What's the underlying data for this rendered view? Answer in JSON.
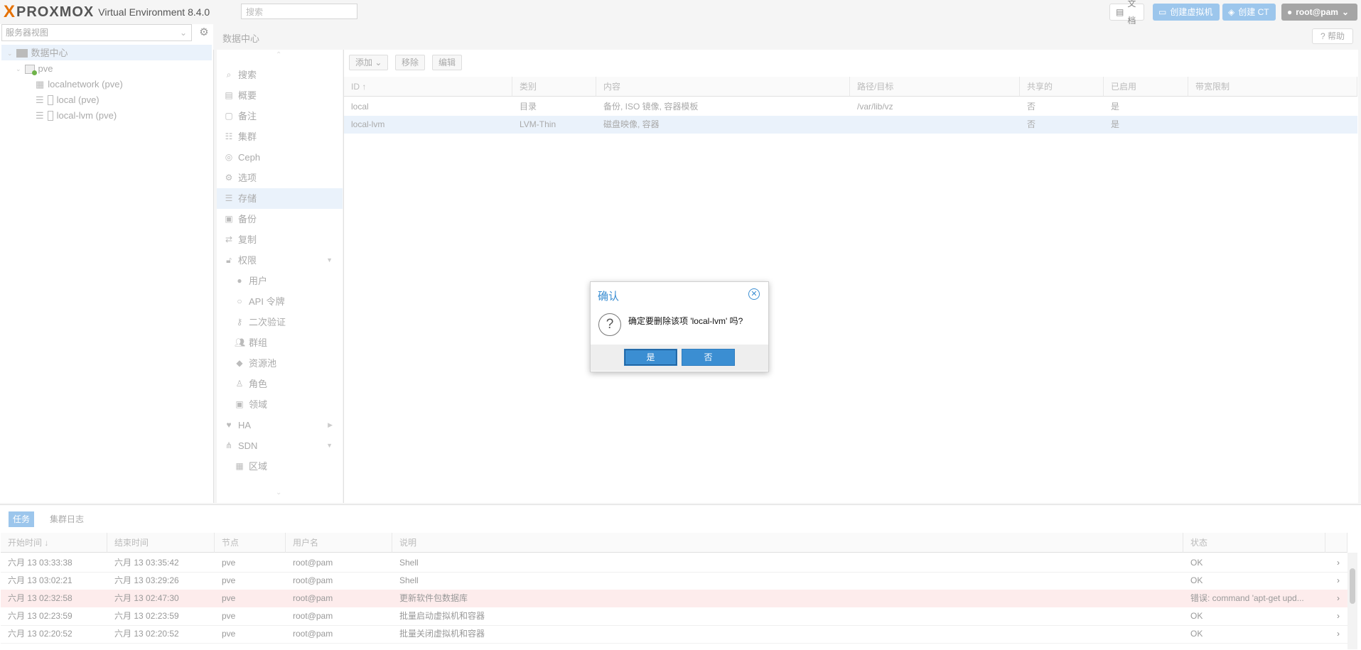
{
  "header": {
    "brand_x": "X",
    "brand": "PROXMOX",
    "version": "Virtual Environment 8.4.0",
    "search_placeholder": "搜索",
    "docs_label": "文档",
    "create_vm_label": "创建虚拟机",
    "create_ct_label": "创建 CT",
    "user_label": "root@pam"
  },
  "left": {
    "view_label": "服务器视图",
    "tree": [
      {
        "label": "数据中心",
        "icon": "datacenter-icon"
      },
      {
        "label": "pve",
        "icon": "node-icon"
      },
      {
        "label": "localnetwork (pve)",
        "icon": "sdn-zone-icon"
      },
      {
        "label": "local (pve)",
        "icon": "storage-icon"
      },
      {
        "label": "local-lvm (pve)",
        "icon": "storage-icon"
      }
    ]
  },
  "content": {
    "title": "数据中心",
    "help_label": "帮助",
    "nav": [
      {
        "label": "搜索",
        "icon": "search-icon"
      },
      {
        "label": "概要",
        "icon": "book-icon"
      },
      {
        "label": "备注",
        "icon": "note-icon"
      },
      {
        "label": "集群",
        "icon": "cluster-icon"
      },
      {
        "label": "Ceph",
        "icon": "ceph-icon"
      },
      {
        "label": "选项",
        "icon": "gear-icon"
      },
      {
        "label": "存储",
        "icon": "database-icon"
      },
      {
        "label": "备份",
        "icon": "floppy-icon"
      },
      {
        "label": "复制",
        "icon": "retweet-icon"
      },
      {
        "label": "权限",
        "icon": "unlock-icon"
      },
      {
        "label": "用户",
        "icon": "user-icon"
      },
      {
        "label": "API 令牌",
        "icon": "token-icon"
      },
      {
        "label": "二次验证",
        "icon": "key-icon"
      },
      {
        "label": "群组",
        "icon": "users-icon"
      },
      {
        "label": "资源池",
        "icon": "tags-icon"
      },
      {
        "label": "角色",
        "icon": "male-icon"
      },
      {
        "label": "领域",
        "icon": "realm-icon"
      },
      {
        "label": "HA",
        "icon": "heartbeat-icon"
      },
      {
        "label": "SDN",
        "icon": "sdn-icon"
      },
      {
        "label": "区域",
        "icon": "zones-icon"
      }
    ],
    "toolbar": {
      "add": "添加",
      "remove": "移除",
      "edit": "编辑"
    },
    "columns": [
      "ID ↑",
      "类别",
      "内容",
      "路径/目标",
      "共享的",
      "已启用",
      "带宽限制"
    ],
    "rows": [
      {
        "id": "local",
        "type": "目录",
        "content": "备份, ISO 镜像, 容器模板",
        "path": "/var/lib/vz",
        "shared": "否",
        "enabled": "是",
        "bw": ""
      },
      {
        "id": "local-lvm",
        "type": "LVM-Thin",
        "content": "磁盘映像, 容器",
        "path": "",
        "shared": "否",
        "enabled": "是",
        "bw": ""
      }
    ]
  },
  "dialog": {
    "title": "确认",
    "message": "确定要删除该项 'local-lvm' 吗?",
    "yes": "是",
    "no": "否"
  },
  "bottom": {
    "tabs": [
      "任务",
      "集群日志"
    ],
    "columns": [
      "开始时间 ↓",
      "结束时间",
      "节点",
      "用户名",
      "说明",
      "状态"
    ],
    "rows": [
      {
        "start": "六月 13 03:33:38",
        "end": "六月 13 03:35:42",
        "node": "pve",
        "user": "root@pam",
        "desc": "Shell",
        "status": "OK"
      },
      {
        "start": "六月 13 03:02:21",
        "end": "六月 13 03:29:26",
        "node": "pve",
        "user": "root@pam",
        "desc": "Shell",
        "status": "OK"
      },
      {
        "start": "六月 13 02:32:58",
        "end": "六月 13 02:47:30",
        "node": "pve",
        "user": "root@pam",
        "desc": "更新软件包数据库",
        "status": "错误: command 'apt-get upd..."
      },
      {
        "start": "六月 13 02:23:59",
        "end": "六月 13 02:23:59",
        "node": "pve",
        "user": "root@pam",
        "desc": "批量启动虚拟机和容器",
        "status": "OK"
      },
      {
        "start": "六月 13 02:20:52",
        "end": "六月 13 02:20:52",
        "node": "pve",
        "user": "root@pam",
        "desc": "批量关闭虚拟机和容器",
        "status": "OK"
      }
    ]
  },
  "colors": {
    "accent": "#3b8ed2",
    "header_button": "#9cc6ec",
    "logo_orange": "#e57000",
    "error_row": "#fdecec"
  }
}
